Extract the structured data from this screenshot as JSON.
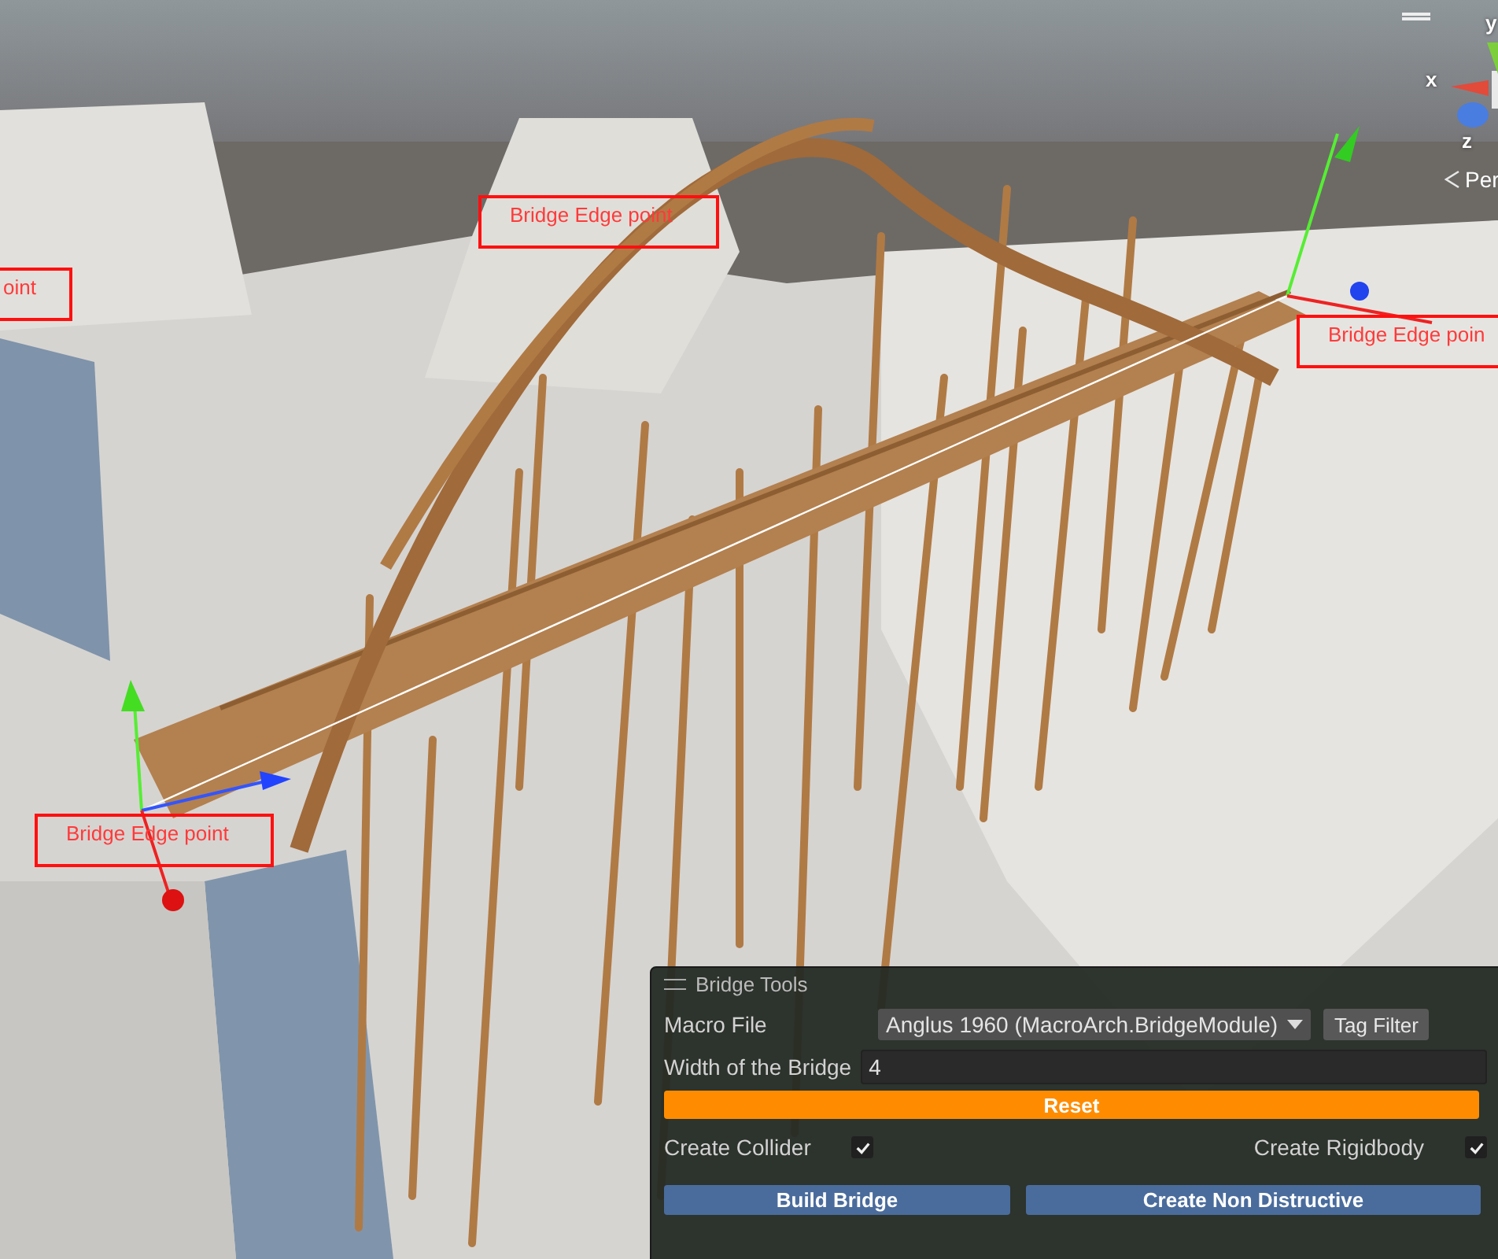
{
  "scene": {
    "labels": [
      {
        "text": "oint"
      },
      {
        "text": "Bridge Edge point"
      },
      {
        "text": "Bridge Edge poin"
      },
      {
        "text": "Bridge Edge point"
      }
    ],
    "gizmo": {
      "axes": [
        "x",
        "y",
        "z"
      ],
      "projection": "Per"
    }
  },
  "panel": {
    "title": "Bridge Tools",
    "macro_file": {
      "label": "Macro File",
      "value": "Anglus 1960 (MacroArch.BridgeModule)"
    },
    "tag_filter": "Tag Filter",
    "width": {
      "label": "Width of the Bridge",
      "value": "4"
    },
    "reset": "Reset",
    "toggles": [
      {
        "label": "Create Collider",
        "checked": true
      },
      {
        "label": "Create Rigidbody",
        "checked": true
      }
    ],
    "buttons": [
      "Build Bridge",
      "Create Non Distructive"
    ]
  }
}
